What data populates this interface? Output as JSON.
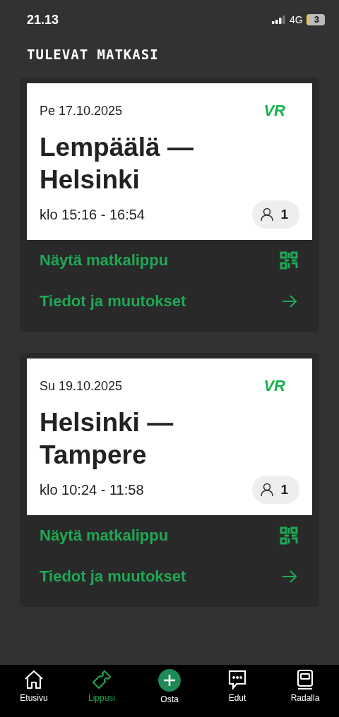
{
  "status_bar": {
    "time": "21.13",
    "network": "4G",
    "battery": "3"
  },
  "title": "TULEVAT MATKASI",
  "trips": [
    {
      "date": "Pe 17.10.2025",
      "logo": "VR",
      "route": "Lempäälä — Helsinki",
      "time": "klo 15:16 - 16:54",
      "passengers": "1",
      "actions": [
        {
          "kind": "qr",
          "label": "Näytä matkalippu"
        },
        {
          "kind": "arrow",
          "label": "Tiedot ja muutokset"
        }
      ]
    },
    {
      "date": "Su 19.10.2025",
      "logo": "VR",
      "route": "Helsinki — Tampere",
      "time": "klo 10:24 - 11:58",
      "passengers": "1",
      "actions": [
        {
          "kind": "qr",
          "label": "Näytä matkalippu"
        },
        {
          "kind": "arrow",
          "label": "Tiedot ja muutokset"
        }
      ]
    }
  ],
  "nav": [
    {
      "kind": "home",
      "label": "Etusivu",
      "selected": false
    },
    {
      "kind": "ticket",
      "label": "Lippusi",
      "selected": true
    },
    {
      "kind": "plus",
      "label": "Osta",
      "selected": false
    },
    {
      "kind": "chat",
      "label": "Edut",
      "selected": false
    },
    {
      "kind": "train",
      "label": "Radalla",
      "selected": false
    }
  ]
}
